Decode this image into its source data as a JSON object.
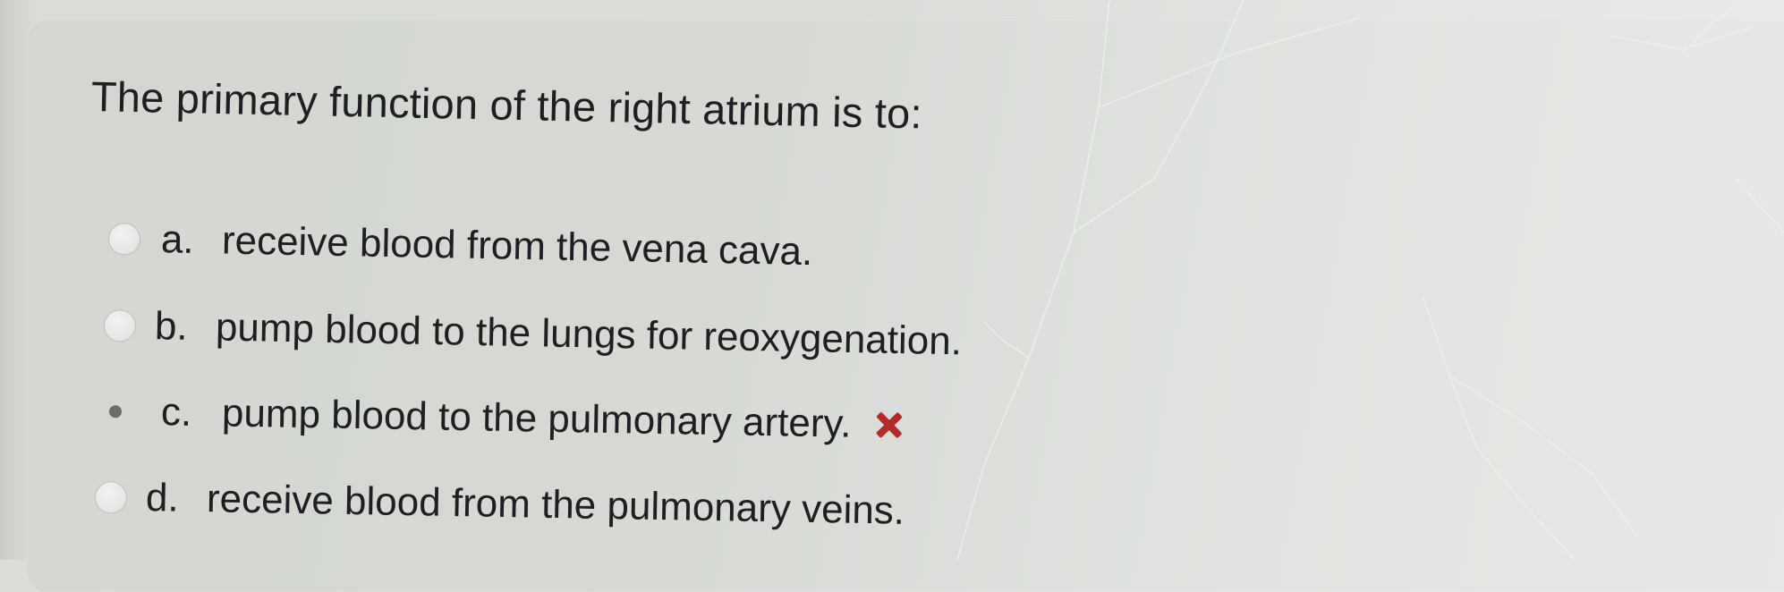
{
  "question": {
    "text": "The primary function of the right atrium is to:"
  },
  "options": [
    {
      "letter": "a.",
      "text": "receive blood from the vena cava.",
      "selected": false
    },
    {
      "letter": "b.",
      "text": "pump blood to the lungs for reoxygenation.",
      "selected": false
    },
    {
      "letter": "c.",
      "text": "pump blood to the pulmonary artery.",
      "selected": true,
      "feedback": "incorrect"
    },
    {
      "letter": "d.",
      "text": "receive blood from the pulmonary veins.",
      "selected": false
    }
  ],
  "colors": {
    "text": "#1e1f1f",
    "incorrect_mark": "#b22a2a",
    "panel": "#d6d9d4"
  },
  "icons": {
    "incorrect": "red-x-icon"
  }
}
